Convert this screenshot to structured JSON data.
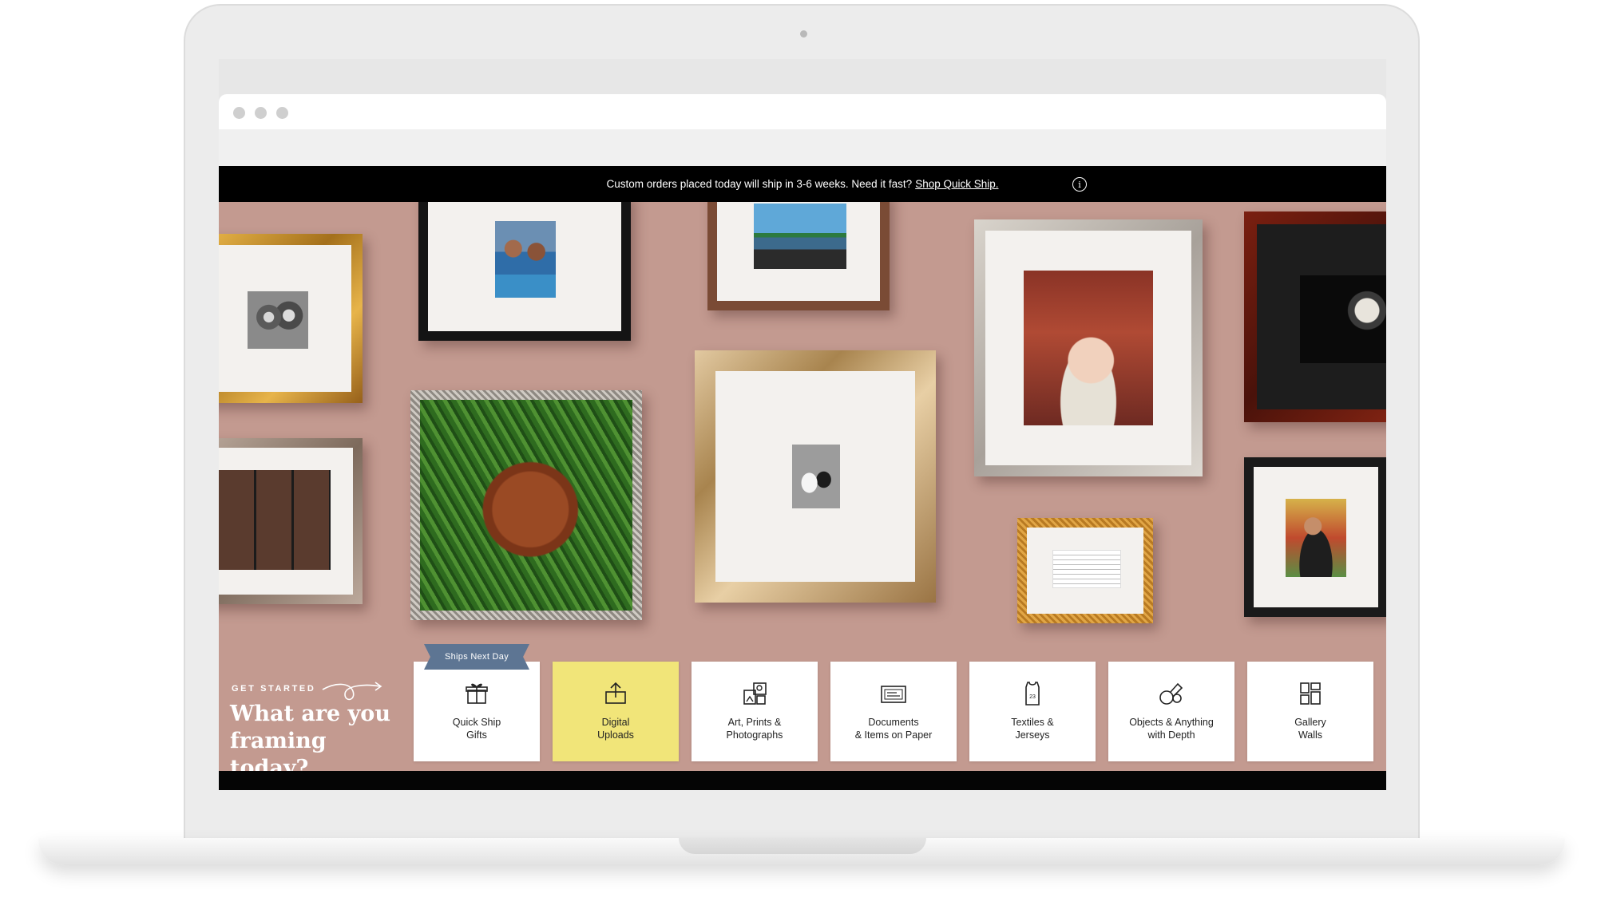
{
  "announcement": {
    "text": "Custom orders placed today will ship in 3-6 weeks. Need it fast?",
    "link": "Shop Quick Ship."
  },
  "hero": {
    "eyebrow": "GET STARTED",
    "title": "What are you framing today?"
  },
  "categories": [
    {
      "label": "Quick Ship\nGifts",
      "icon": "gift-icon",
      "badge": "Ships Next Day"
    },
    {
      "label": "Digital\nUploads",
      "icon": "upload-icon"
    },
    {
      "label": "Art, Prints &\nPhotographs",
      "icon": "photos-icon"
    },
    {
      "label": "Documents\n& Items on Paper",
      "icon": "document-icon"
    },
    {
      "label": "Textiles &\nJerseys",
      "icon": "jersey-icon"
    },
    {
      "label": "Objects & Anything\nwith Depth",
      "icon": "objects-icon"
    },
    {
      "label": "Gallery\nWalls",
      "icon": "gallery-wall-icon"
    }
  ],
  "jersey_number": "23",
  "colors": {
    "wall": "#c39a90",
    "highlight_card": "#f1e579",
    "ribbon": "#5d7593",
    "announcement_bg": "#000000"
  }
}
